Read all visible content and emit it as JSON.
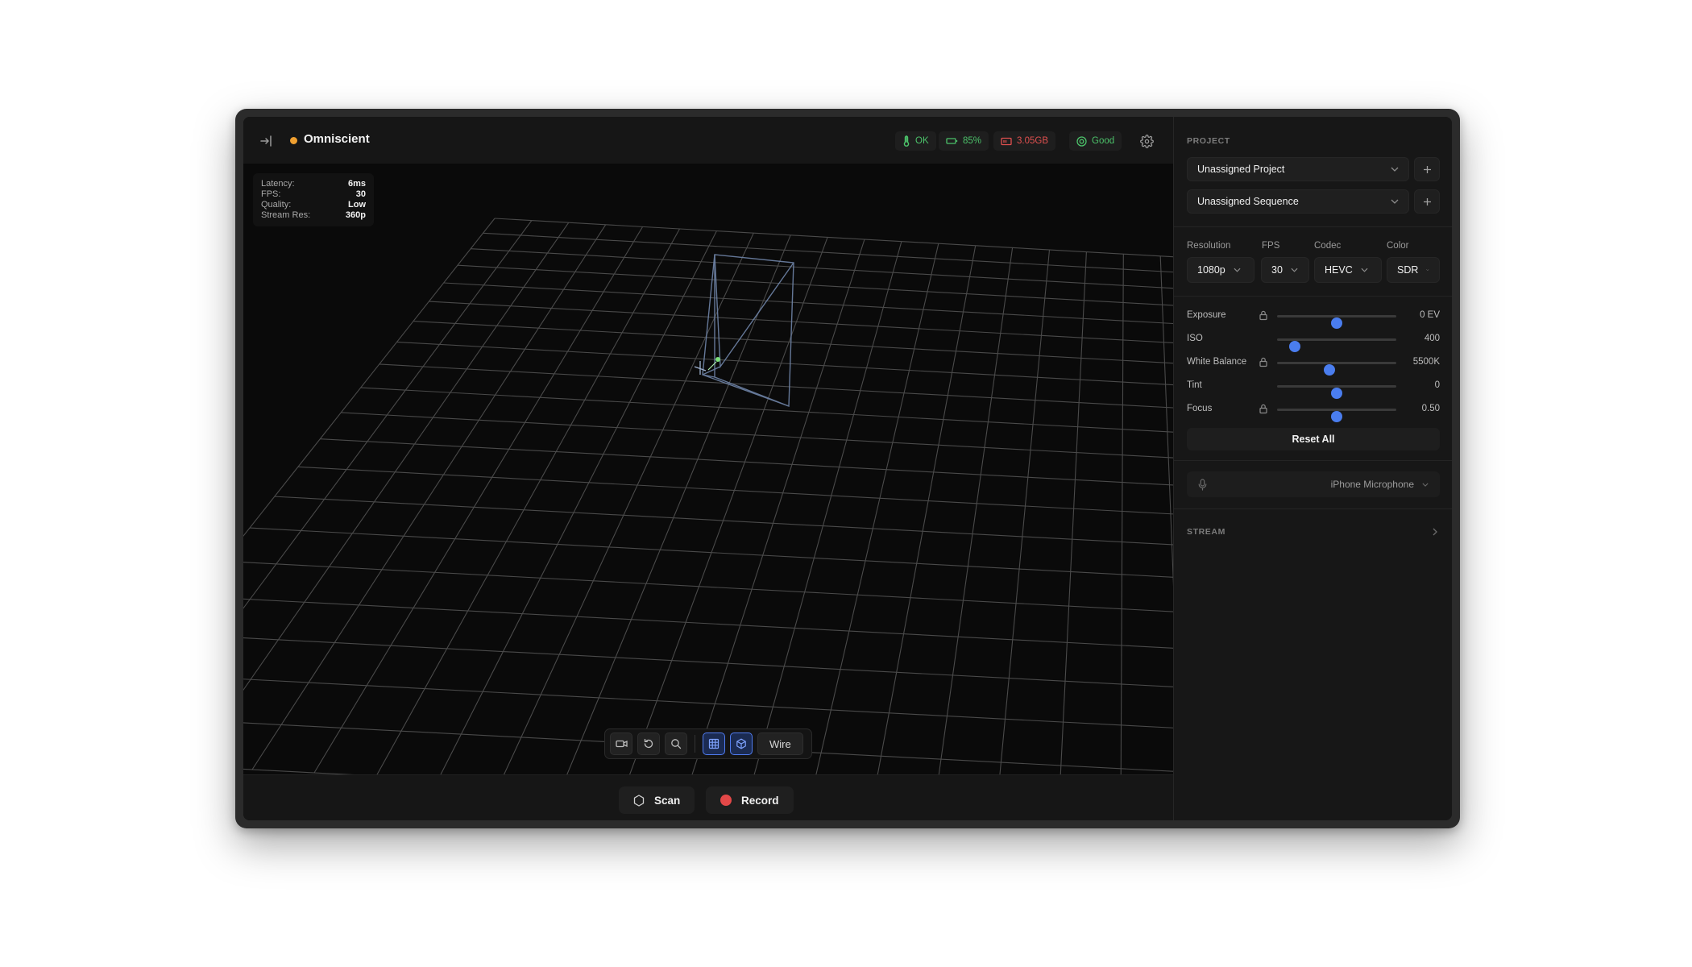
{
  "app": {
    "title": "Omniscient",
    "status_color": "#f0a030"
  },
  "status_chips": {
    "thermal": {
      "label": "OK",
      "icon": "thermometer-icon",
      "color": "#4cc26a"
    },
    "battery": {
      "label": "85%",
      "icon": "battery-icon",
      "color": "#4cc26a"
    },
    "storage": {
      "label": "3.05GB",
      "icon": "storage-icon",
      "color": "#e0504f"
    },
    "connection": {
      "label": "Good",
      "icon": "signal-icon",
      "color": "#4cc26a"
    }
  },
  "stats": {
    "latency": {
      "label": "Latency:",
      "value": "6ms"
    },
    "fps": {
      "label": "FPS:",
      "value": "30"
    },
    "quality": {
      "label": "Quality:",
      "value": "Low"
    },
    "stream_res": {
      "label": "Stream Res:",
      "value": "360p"
    }
  },
  "viewport_toolbar": {
    "camera_icon": "camera-icon",
    "reset_icon": "rotate-ccw-icon",
    "zoom_icon": "search-icon",
    "grid_icon": "grid-icon",
    "cube_icon": "cube-icon",
    "wire_label": "Wire"
  },
  "actions": {
    "scan_label": "Scan",
    "record_label": "Record"
  },
  "panel": {
    "project_section": "PROJECT",
    "project_select": "Unassigned Project",
    "sequence_select": "Unassigned Sequence",
    "format": {
      "resolution": {
        "label": "Resolution",
        "value": "1080p"
      },
      "fps": {
        "label": "FPS",
        "value": "30"
      },
      "codec": {
        "label": "Codec",
        "value": "HEVC"
      },
      "color": {
        "label": "Color",
        "value": "SDR"
      }
    },
    "sliders": {
      "exposure": {
        "label": "Exposure",
        "value": "0 EV",
        "level": 0.5,
        "locked_icon": true
      },
      "iso": {
        "label": "ISO",
        "value": "400",
        "level": 0.15,
        "locked_icon": false
      },
      "white_balance": {
        "label": "White Balance",
        "value": "5500K",
        "level": 0.44,
        "locked_icon": true
      },
      "tint": {
        "label": "Tint",
        "value": "0",
        "level": 0.5,
        "locked_icon": false
      },
      "focus": {
        "label": "Focus",
        "value": "0.50",
        "level": 0.5,
        "locked_icon": true
      }
    },
    "reset_label": "Reset All",
    "microphone": "iPhone Microphone",
    "stream_section": "STREAM"
  },
  "colors": {
    "accent": "#4a7dee",
    "record": "#e34848"
  }
}
